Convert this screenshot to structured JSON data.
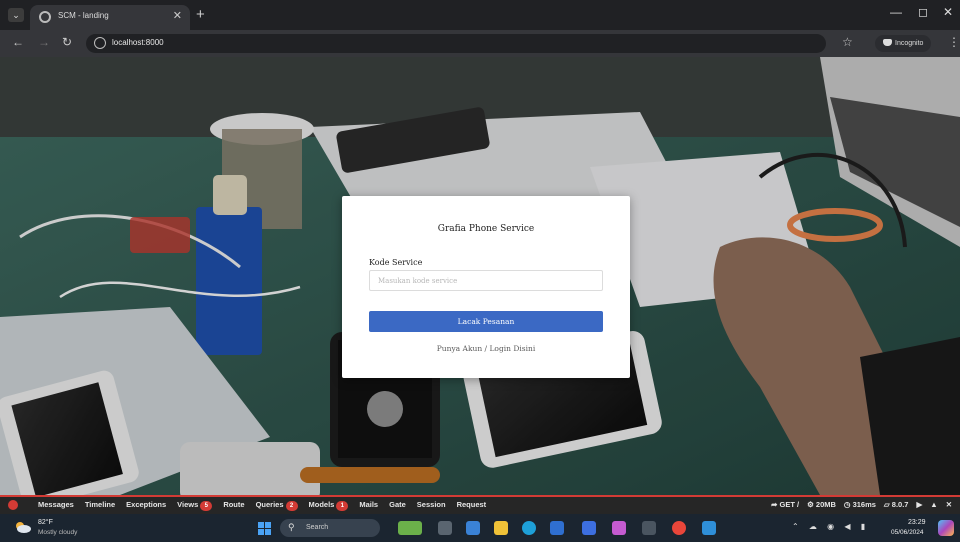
{
  "browser": {
    "tab_title": "SCM - landing",
    "url": "localhost:8000",
    "profile_label": "Incognito"
  },
  "card": {
    "title": "Grafia Phone Service",
    "field_label": "Kode Service",
    "field_placeholder": "Masukan kode service",
    "field_value": "",
    "button_label": "Lacak Pesanan",
    "login_link": "Punya Akun / Login Disini"
  },
  "debugbar": {
    "tabs": [
      {
        "label": "Messages"
      },
      {
        "label": "Timeline"
      },
      {
        "label": "Exceptions"
      },
      {
        "label": "Views",
        "badge": "5"
      },
      {
        "label": "Route"
      },
      {
        "label": "Queries",
        "badge": "2"
      },
      {
        "label": "Models",
        "badge": "1"
      },
      {
        "label": "Mails"
      },
      {
        "label": "Gate"
      },
      {
        "label": "Session"
      },
      {
        "label": "Request"
      }
    ],
    "method": "GET /",
    "memory": "20MB",
    "time": "316ms",
    "version": "8.0.7"
  },
  "taskbar": {
    "temperature": "82°F",
    "weather": "Mostly cloudy",
    "search_placeholder": "Search",
    "time": "23:29",
    "date": "05/06/2024"
  },
  "colors": {
    "primary_button": "#3b69c4",
    "debugbar_accent": "#d33b35",
    "taskbar": "#1b2530"
  }
}
